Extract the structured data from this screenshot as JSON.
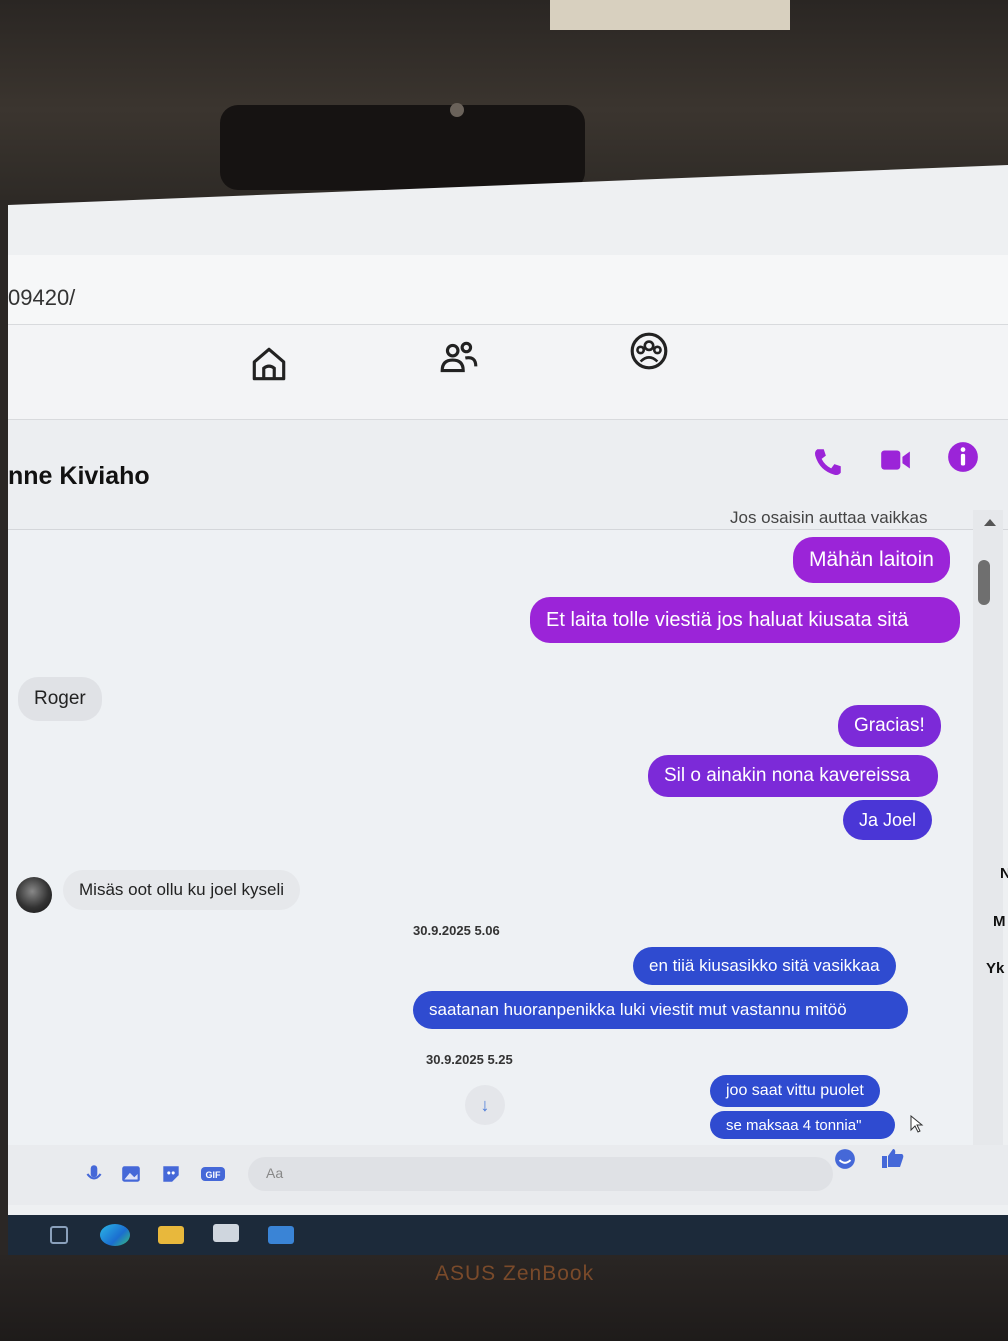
{
  "browser": {
    "url_fragment": "09420/"
  },
  "nav": {
    "icons": [
      "home-icon",
      "friends-icon",
      "groups-icon"
    ]
  },
  "conversation": {
    "contact_name": "nne Kiviaho",
    "header_icons": [
      "phone-icon",
      "video-call-icon",
      "info-icon"
    ],
    "accent_color": "#9b24d8"
  },
  "messages": {
    "partial_top": "Jos osaisin auttaa vaikkas",
    "m1": "Mähän laitoin",
    "m2": "Et laita tolle viestiä jos haluat kiusata sitä",
    "m3": "Roger",
    "m4": "Gracias!",
    "m5": "Sil o ainakin nona kavereissa",
    "m6": "Ja Joel",
    "m7": "Misäs oot ollu ku joel kyseli",
    "ts1": "30.9.2025 5.06",
    "m8": "en tiiä kiusasikko sitä vasikkaa",
    "m9": "saatanan huoranpenikka luki viestit mut vastannu mitöö",
    "ts2": "30.9.2025 5.25",
    "m10": "joo saat vittu puolet",
    "m11": "se maksaa 4 tonnia\""
  },
  "sidebar_fragments": {
    "a": "N",
    "b": "M",
    "c": "Yk"
  },
  "composer": {
    "placeholder": "Aa",
    "icons": [
      "microphone-icon",
      "image-icon",
      "sticker-icon",
      "gif-icon",
      "emoji-icon",
      "like-icon"
    ]
  },
  "taskbar": {
    "icons": [
      "task-view-icon",
      "edge-icon",
      "file-explorer-icon",
      "store-icon",
      "mail-icon"
    ]
  },
  "laptop": {
    "brand": "ASUS ZenBook"
  }
}
